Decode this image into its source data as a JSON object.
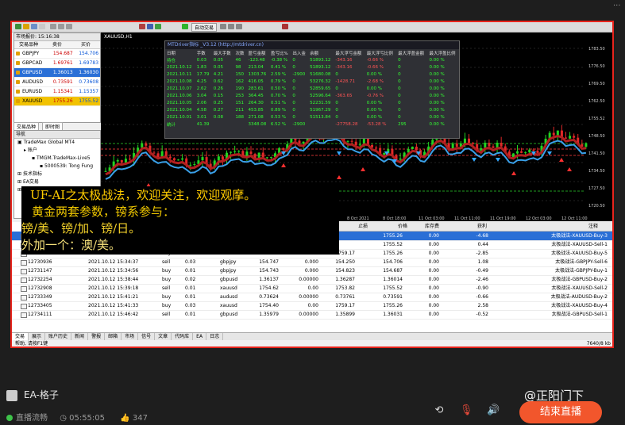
{
  "window": {
    "menu_dots": "···"
  },
  "toolbar": {
    "autotrade_label": "自动交易"
  },
  "market_watch": {
    "header": "市场报价: 15:16:38",
    "columns": [
      "交易品种",
      "卖价",
      "买价"
    ],
    "rows": [
      {
        "symbol": "GBPJPY",
        "bid": "154.687",
        "ask": "154.706",
        "style": "normal"
      },
      {
        "symbol": "GBPCAD",
        "bid": "1.69761",
        "ask": "1.69783",
        "style": "normal"
      },
      {
        "symbol": "GBPUSD",
        "bid": "1.36013",
        "ask": "1.36030",
        "style": "selected"
      },
      {
        "symbol": "AUDUSD",
        "bid": "0.73591",
        "ask": "0.73608",
        "style": "normal"
      },
      {
        "symbol": "EURUSD",
        "bid": "1.15341",
        "ask": "1.15357",
        "style": "normal"
      },
      {
        "symbol": "XAUUSD",
        "bid": "1755.26",
        "ask": "1755.52",
        "style": "yellow"
      }
    ],
    "tabs": [
      "交易品种",
      "即时图"
    ]
  },
  "navigator": {
    "header": "导航",
    "items": [
      "TradeMax Global MT4",
      "账户",
      "TMGM.TradeMax-Live5",
      "5000539: Tong Fung",
      "技术指标",
      "EA交易",
      "脚本"
    ]
  },
  "chart": {
    "title": "XAUUSD,H1",
    "indicator_title": "MTDriver指标 _V3.12 (http://mtdriver.cn)",
    "indicator_columns": [
      "日期",
      "手数",
      "最大手数",
      "次数",
      "盈亏金额",
      "盈亏比%",
      "出入金",
      "余额",
      "最大浮亏金额",
      "最大浮亏比例",
      "最大浮盈金额",
      "最大浮盈比例"
    ],
    "indicator_rows": [
      [
        "持仓",
        "0.03",
        "0.05",
        "46",
        "-123.48",
        "-0.38 %",
        "0",
        "51893.12",
        "-343.16",
        "-0.66 %",
        "0",
        "0.00 %"
      ],
      [
        "2021.10.12",
        "1.83",
        "0.05",
        "98",
        "213.04",
        "0.41 %",
        "0",
        "51893.12",
        "-343.16",
        "-0.66 %",
        "0",
        "0.00 %"
      ],
      [
        "2021.10.11",
        "17.79",
        "4.21",
        "150",
        "1303.76",
        "2.59 %",
        "-2900",
        "51680.08",
        "0",
        "0.00 %",
        "0",
        "0.00 %"
      ],
      [
        "2021.10.08",
        "4.25",
        "0.62",
        "162",
        "416.05",
        "0.79 %",
        "0",
        "53276.32",
        "-1428.71",
        "-2.68 %",
        "0",
        "0.00 %"
      ],
      [
        "2021.10.07",
        "2.62",
        "0.26",
        "190",
        "283.61",
        "0.50 %",
        "0",
        "52859.65",
        "0",
        "0.00 %",
        "0",
        "0.00 %"
      ],
      [
        "2021.10.06",
        "3.04",
        "0.15",
        "253",
        "364.45",
        "0.70 %",
        "0",
        "52596.64",
        "-363.65",
        "-0.76 %",
        "0",
        "0.00 %"
      ],
      [
        "2021.10.05",
        "2.06",
        "0.25",
        "151",
        "264.30",
        "0.51 %",
        "0",
        "52231.59",
        "0",
        "0.00 %",
        "0",
        "0.00 %"
      ],
      [
        "2021.10.04",
        "4.58",
        "0.27",
        "211",
        "453.85",
        "0.89 %",
        "0",
        "51967.29",
        "0",
        "0.00 %",
        "0",
        "0.00 %"
      ],
      [
        "2021.10.01",
        "3.01",
        "0.08",
        "188",
        "271.08",
        "0.53 %",
        "0",
        "51513.84",
        "0",
        "0.00 %",
        "0",
        "0.00 %"
      ],
      [
        "统计",
        "41.39",
        "",
        "",
        "3348.08",
        "6.52 %",
        "-2900",
        "",
        "-27758.28",
        "-53.28 %",
        "295",
        "0.00 %"
      ]
    ],
    "price_labels": [
      "1783.50",
      "1776.50",
      "1769.50",
      "1762.50",
      "1755.52",
      "1748.50",
      "1741.50",
      "1734.50",
      "1727.50",
      "1720.50"
    ],
    "time_labels": [
      "8 Oct 2021",
      "8 Oct 18:00",
      "11 Oct 03:00",
      "11 Oct 11:00",
      "11 Oct 19:00",
      "12 Oct 03:00",
      "12 Oct 11:00"
    ]
  },
  "overlay": {
    "line1": "UF-AI之太极战法，欢迎关注，欢迎观摩。",
    "line2": "黄金两套参数，镑系参与：",
    "line3": "镑/美、镑/加、镑/日。",
    "line4": "外加一个：澳/美。"
  },
  "orders": {
    "columns": [
      "止损",
      "价格",
      "库存费",
      "获利",
      "注释"
    ],
    "rows": [
      {
        "ticket": "",
        "time": "",
        "type": "",
        "volume": "",
        "symbol": "",
        "open": "",
        "sl": "1763.43",
        "tp": "",
        "price": "1755.26",
        "swap": "0.00",
        "profit": "-4.68",
        "comment": "太极战法-XAUUSD-Buy-3",
        "selected": true
      },
      {
        "ticket": "",
        "time": "",
        "type": "",
        "volume": "",
        "symbol": "",
        "open": "",
        "sl": "1752.96",
        "tp": "",
        "price": "1755.52",
        "swap": "0.00",
        "profit": "0.44",
        "comment": "太极战法-XAUUSD-Sell-1",
        "selected": false
      },
      {
        "ticket": "12730935",
        "time": "2021.10.12 15:34:37",
        "type": "buy",
        "volume": "0.03",
        "symbol": "xauusd",
        "open": "1756.21",
        "sl": "0.00",
        "tp": "1759.17",
        "price": "1755.26",
        "swap": "0.00",
        "profit": "-2.85",
        "comment": "太极战法-XAUUSD-Buy-5",
        "selected": false
      },
      {
        "ticket": "12730936",
        "time": "2021.10.12 15:34:37",
        "type": "sell",
        "volume": "0.03",
        "symbol": "gbpjpy",
        "open": "154.747",
        "sl": "0.000",
        "tp": "154.250",
        "price": "154.706",
        "swap": "0.00",
        "profit": "1.08",
        "comment": "太极战法-GBPJPY-Sell-6",
        "selected": false
      },
      {
        "ticket": "12731147",
        "time": "2021.10.12 15:34:56",
        "type": "buy",
        "volume": "0.01",
        "symbol": "gbpjpy",
        "open": "154.743",
        "sl": "0.000",
        "tp": "154.823",
        "price": "154.687",
        "swap": "0.00",
        "profit": "-0.49",
        "comment": "太极战法-GBPJPY-Buy-1",
        "selected": false
      },
      {
        "ticket": "12732254",
        "time": "2021.10.12 15:38:44",
        "type": "buy",
        "volume": "0.02",
        "symbol": "gbpusd",
        "open": "1.36137",
        "sl": "0.00000",
        "tp": "1.36287",
        "price": "1.36014",
        "swap": "0.00",
        "profit": "-2.46",
        "comment": "太极战法-GBPUSD-Buy-2",
        "selected": false
      },
      {
        "ticket": "12732908",
        "time": "2021.10.12 15:39:18",
        "type": "sell",
        "volume": "0.01",
        "symbol": "xauusd",
        "open": "1754.62",
        "sl": "0.00",
        "tp": "1753.82",
        "price": "1755.52",
        "swap": "0.00",
        "profit": "-0.90",
        "comment": "太极战法-XAUUSD-Sell-2",
        "selected": false
      },
      {
        "ticket": "12733349",
        "time": "2021.10.12 15:41:21",
        "type": "buy",
        "volume": "0.01",
        "symbol": "audusd",
        "open": "0.73624",
        "sl": "0.00000",
        "tp": "0.73761",
        "price": "0.73591",
        "swap": "0.00",
        "profit": "-0.66",
        "comment": "太极战法-AUDUSD-Buy-2",
        "selected": false
      },
      {
        "ticket": "12733405",
        "time": "2021.10.12 15:41:33",
        "type": "buy",
        "volume": "0.03",
        "symbol": "xauusd",
        "open": "1754.40",
        "sl": "0.00",
        "tp": "1759.17",
        "price": "1755.26",
        "swap": "0.00",
        "profit": "2.58",
        "comment": "太极战法-XAUUSD-Buy-4",
        "selected": false
      },
      {
        "ticket": "12734111",
        "time": "2021.10.12 15:46:42",
        "type": "sell",
        "volume": "0.01",
        "symbol": "gbpusd",
        "open": "1.35979",
        "sl": "0.00000",
        "tp": "1.35899",
        "price": "1.36031",
        "swap": "0.00",
        "profit": "-0.52",
        "comment": "太极战法-GBPUSD-Sell-1",
        "selected": false
      }
    ]
  },
  "bottom_tabs": [
    "交易",
    "展示",
    "账户历史",
    "新闻",
    "警报",
    "邮箱",
    "市场",
    "信号",
    "文章",
    "代码库",
    "EA",
    "日志"
  ],
  "status_bar": {
    "left": "帮助, 请按F1键",
    "right": "7640/8 kb"
  },
  "stream": {
    "streamer_name": "EA-格子",
    "status": "直播流畅",
    "duration": "05:55:05",
    "likes": "347",
    "end_button": "结束直播",
    "watermark": "@正阳门下"
  }
}
